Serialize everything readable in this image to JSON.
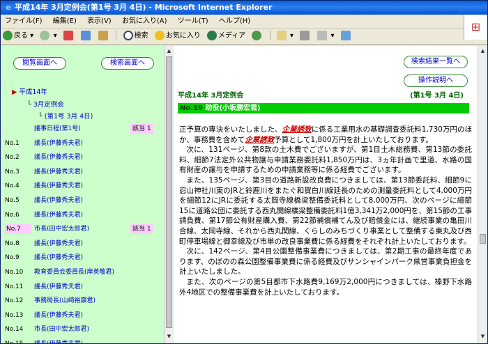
{
  "window": {
    "title": "平成14年 3月定例会(第1号 3月 4日) - Microsoft Internet Explorer"
  },
  "menu": [
    "ファイル(F)",
    "編集(E)",
    "表示(V)",
    "お気に入り(A)",
    "ツール(T)",
    "ヘルプ(H)"
  ],
  "toolbar": {
    "back": "戻る",
    "search": "検索",
    "favorites": "お気に入り",
    "media": "メディア"
  },
  "left": {
    "btn_browse": "閲覧画面へ",
    "btn_search": "検索画面へ",
    "tree_root": "平成14年",
    "tree_session": "3月定例会",
    "tree_day": "(第1号 3月 4日)",
    "items": [
      {
        "num": "",
        "text": "議事日程(第1号)",
        "hit": "該当 1",
        "hl": false
      },
      {
        "num": "No.1",
        "text": "議長(伊藤秀夫君)",
        "hit": "",
        "hl": false
      },
      {
        "num": "No.2",
        "text": "議長(伊藤秀夫君)",
        "hit": "",
        "hl": false
      },
      {
        "num": "No.3",
        "text": "議長(伊藤秀夫君)",
        "hit": "",
        "hl": false
      },
      {
        "num": "No.4",
        "text": "議長(伊藤秀夫君)",
        "hit": "",
        "hl": false
      },
      {
        "num": "No.5",
        "text": "議長(伊藤秀夫君)",
        "hit": "",
        "hl": false
      },
      {
        "num": "No.6",
        "text": "議長(伊藤秀夫君)",
        "hit": "",
        "hl": false
      },
      {
        "num": "No.7",
        "text": "市長(田中宏太郎君)",
        "hit": "該当 1",
        "hl": true
      },
      {
        "num": "No.8",
        "text": "議長(伊藤秀夫君)",
        "hit": "",
        "hl": false
      },
      {
        "num": "No.9",
        "text": "議長(伊藤秀夫君)",
        "hit": "",
        "hl": false
      },
      {
        "num": "No.10",
        "text": "教育委員会委員長(岸英敬君)",
        "hit": "",
        "hl": false
      },
      {
        "num": "No.11",
        "text": "議長(伊藤秀夫君)",
        "hit": "",
        "hl": false
      },
      {
        "num": "No.12",
        "text": "事務局長(山崎裕康君)",
        "hit": "",
        "hl": false
      },
      {
        "num": "No.13",
        "text": "議長(伊藤秀夫君)",
        "hit": "",
        "hl": false
      },
      {
        "num": "No.14",
        "text": "市長(田中宏太郎君)",
        "hit": "",
        "hl": false
      },
      {
        "num": "No.15",
        "text": "議長(伊藤秀夫君)",
        "hit": "",
        "hl": false
      }
    ]
  },
  "right": {
    "btn_results": "検索結果一覧へ",
    "btn_help": "操作説明へ",
    "session_title": "平成14年 3月定例会",
    "session_no": "(第1号 3月 4日)",
    "speaker_no": "No.19",
    "speaker_name": "助役(小坂勝宏君)",
    "p1_a": "正予算の専決をいたしました、",
    "p1_kw1": "企業誘致",
    "p1_b": "に係る工業用水の基礎調査委託料1,730万円のほか、事務費を含めて",
    "p1_kw2": "企業誘致",
    "p1_c": "予算として1,800万円を計上いたしております。",
    "p2": "次に、131ページ、第8款の土木費でございますが、第1目土木総務費、第13節の委託料、細節7法定外公共物譲与申請業務委託料1,850万円は、3ヵ年計画で里道、水路の国有財産の譲与を申請するための申請業務等に係る経費でございます。",
    "p3": "また、135ページ、第3目の道路新設改良費につきましては、第13節委託料、細節9に忍山神社川東のJRと鈴鹿川をまたぐ和賀白川線延長のための測量委託料として4,000万円を細節12にJRに委託する太岡寺線橋梁整備委託料として8,000万円、次のページに細節15に道路公団に委託する西丸関線橋梁整備委託料1億3,341万2,000円を、第15節の工事請負費、第17節公有財産購入費、第22節補償補てん及び賠償金には、継続事業の亀田川合線、太岡寺線、それから西丸関線、くらしのみちづくり事業として整備する東丸及び西町停車場線と御幸線及び市単の改良事業費に係る経費をそれぞれ計上いたしております。",
    "p4": "次に、142ページ、第4目公園整備事業費につきましては、第2期工事の最終年度であります、のぼのの森公園整備事業費に係る経費及びサンシャインパーク県営事業負担金を計上いたしました。",
    "p5": "また、次のページの第5目都市下水路費9,169万2,000円につきましては、榛野下水路外4地区での整備事業費を計上いたしております。"
  }
}
